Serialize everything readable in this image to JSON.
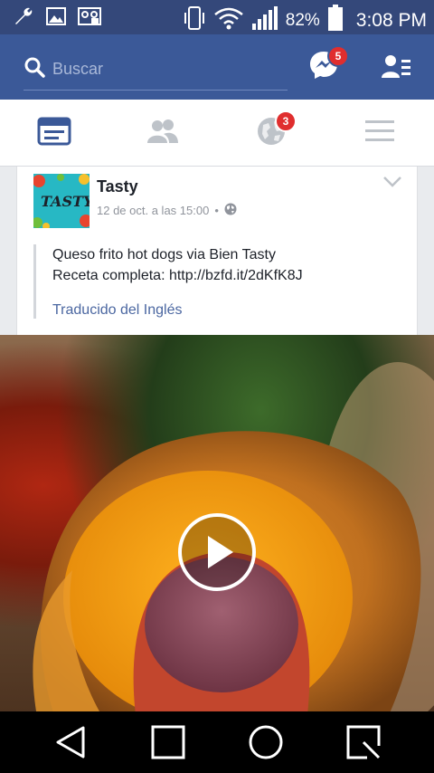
{
  "status_bar": {
    "battery_percent": "82%",
    "time": "3:08 PM"
  },
  "appbar": {
    "search_placeholder": "Buscar",
    "messenger_badge": "5"
  },
  "tabs": {
    "notifications_badge": "3"
  },
  "post": {
    "author": "Tasty",
    "avatar_text": "TASTY",
    "timestamp": "12 de oct. a las 15:00",
    "separator": "•",
    "line1": "Queso frito hot dogs via Bien Tasty",
    "line2": "Receta completa: http://bzfd.it/2dKfK8J",
    "translated_label": "Traducido del Inglés"
  },
  "colors": {
    "brand": "#3b5998",
    "status_bar": "#34487a",
    "badge": "#e02e2e",
    "link": "#4b67a1"
  },
  "icons": [
    "wrench-icon",
    "image-icon",
    "voicemail-icon",
    "vibrate-icon",
    "wifi-icon",
    "signal-icon",
    "battery-icon",
    "search-icon",
    "messenger-icon",
    "friend-requests-icon",
    "news-feed-icon",
    "groups-icon",
    "globe-notifications-icon",
    "menu-icon",
    "chevron-down-icon",
    "public-globe-icon",
    "play-icon",
    "back-icon",
    "home-icon",
    "recents-icon"
  ]
}
